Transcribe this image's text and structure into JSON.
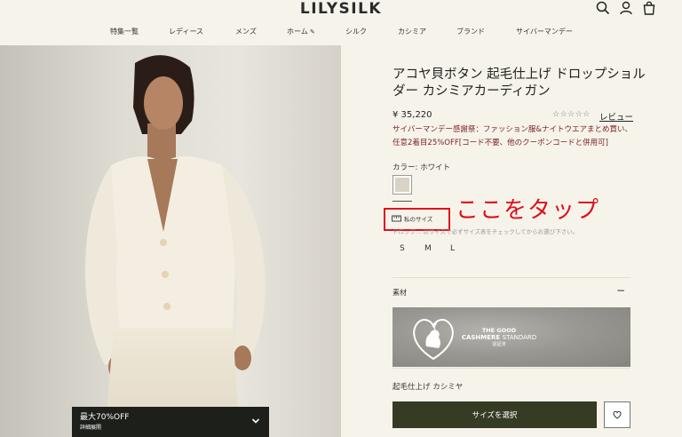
{
  "header": {
    "logo": "LILYSILK",
    "icons": [
      "search-icon",
      "user-icon",
      "cart-icon"
    ]
  },
  "nav": {
    "items": [
      "特集一覧",
      "レディース",
      "メンズ",
      "ホーム",
      "シルク",
      "カシミア",
      "ブランド",
      "サイバーマンデー"
    ]
  },
  "promo": {
    "title": "最大70%OFF",
    "detail": "詳細展開"
  },
  "product": {
    "title": "アコヤ貝ボタン 起毛仕上げ ドロップショルダー カシミアカーディガン",
    "price": "¥ 35,220",
    "stars": "☆☆☆☆☆",
    "review_link": "レビュー",
    "sale_text": "サイバーマンデー感謝祭：ファッション服&ナイトウエアまとめ買い、任意2着目25%OFF[コード不要、他のクーポンコードと併用可]",
    "color_label": "カラー: ホワイト",
    "size_guide": "私のサイズ",
    "size_note": "ドロップ... 以サイズで必ずサイズ表をチェックしてからお選び下さい。",
    "sizes": [
      "S",
      "M",
      "L"
    ],
    "material_label": "素材",
    "material_toggle": "−",
    "cashmere_badge": {
      "line1": "THE GOOD",
      "line2": "CASHMERE",
      "line2b": "STANDARD",
      "line3": "認証済"
    },
    "fabric": "起毛仕上げ カシミヤ",
    "select_button": "サイズを選択"
  },
  "annotation": {
    "tap_text": "ここをタップ"
  },
  "colors": {
    "accent_red": "#e0101a",
    "button_dark": "#363b23",
    "sale_text": "#7a1e24",
    "background": "#f6f4ea"
  }
}
